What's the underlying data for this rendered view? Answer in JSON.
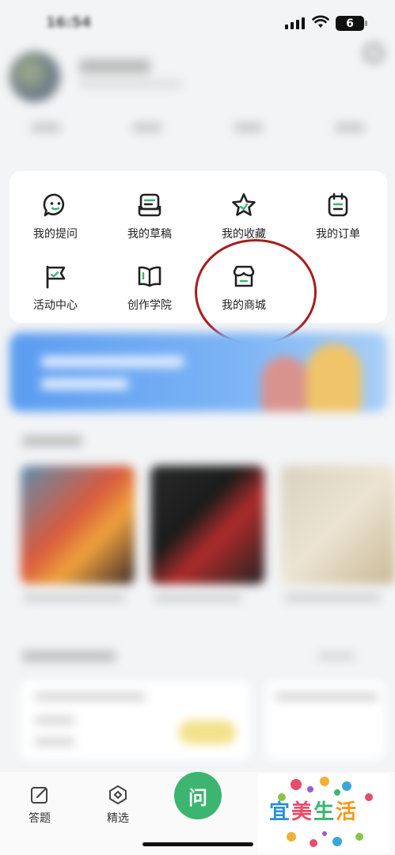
{
  "status_bar": {
    "battery": "6"
  },
  "menu": {
    "items": [
      {
        "label": "我的提问",
        "icon": "chat-face-icon"
      },
      {
        "label": "我的草稿",
        "icon": "drafts-icon"
      },
      {
        "label": "我的收藏",
        "icon": "star-icon"
      },
      {
        "label": "我的订单",
        "icon": "order-icon"
      },
      {
        "label": "活动中心",
        "icon": "flag-icon"
      },
      {
        "label": "创作学院",
        "icon": "book-icon"
      },
      {
        "label": "我的商城",
        "icon": "store-icon"
      }
    ]
  },
  "tab_bar": {
    "answer_label": "答题",
    "featured_label": "精选",
    "ask_label": "问"
  },
  "watermark": {
    "text": [
      "宜",
      "美",
      "生",
      "活"
    ]
  },
  "colors": {
    "accent_green": "#3bb56f",
    "highlight_red": "#a81d1d",
    "banner_blue": "#5b9cf0"
  }
}
